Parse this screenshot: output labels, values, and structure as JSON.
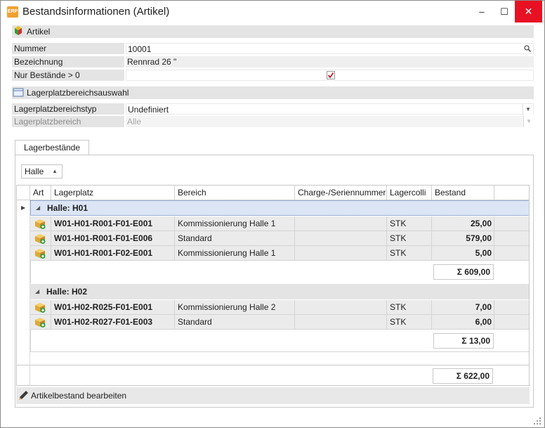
{
  "window": {
    "title": "Bestandsinformationen (Artikel)",
    "app_icon_text": "ERP",
    "minimize_glyph": "–",
    "maximize_glyph": "☐",
    "close_glyph": "✕"
  },
  "artikel_section": {
    "header": "Artikel",
    "fields": {
      "nummer_label": "Nummer",
      "nummer_value": "10001",
      "bezeichnung_label": "Bezeichnung",
      "bezeichnung_value": "Rennrad 26 \"",
      "nur_bestaende_label": "Nur Bestände > 0",
      "nur_bestaende_checked": true
    }
  },
  "lagerplatz_section": {
    "header": "Lagerplatzbereichsauswahl",
    "fields": {
      "typ_label": "Lagerplatzbereichstyp",
      "typ_value": "Undefiniert",
      "bereich_label": "Lagerplatzbereich",
      "bereich_value": "Alle"
    }
  },
  "tabs": {
    "active": "Lagerbestände"
  },
  "group_by_chip": {
    "label": "Halle",
    "sort_arrow": "▲"
  },
  "grid": {
    "columns": [
      "Art",
      "Lagerplatz",
      "Bereich",
      "Charge-/Seriennummer",
      "Lagercolli",
      "Bestand"
    ],
    "groups": [
      {
        "label": "Halle: H01",
        "rows": [
          {
            "lagerplatz": "W01-H01-R001-F01-E001",
            "bereich": "Kommissionierung Halle 1",
            "charge": "",
            "lagercolli": "STK",
            "bestand": "25,00"
          },
          {
            "lagerplatz": "W01-H01-R001-F01-E006",
            "bereich": "Standard",
            "charge": "",
            "lagercolli": "STK",
            "bestand": "579,00"
          },
          {
            "lagerplatz": "W01-H01-R001-F02-E001",
            "bereich": "Kommissionierung Halle 1",
            "charge": "",
            "lagercolli": "STK",
            "bestand": "5,00"
          }
        ],
        "sum": "Σ 609,00"
      },
      {
        "label": "Halle: H02",
        "rows": [
          {
            "lagerplatz": "W01-H02-R025-F01-E001",
            "bereich": "Kommissionierung Halle 2",
            "charge": "",
            "lagercolli": "STK",
            "bestand": "7,00"
          },
          {
            "lagerplatz": "W01-H02-R027-F01-E003",
            "bereich": "Standard",
            "charge": "",
            "lagercolli": "STK",
            "bestand": "6,00"
          }
        ],
        "sum": "Σ 13,00"
      }
    ],
    "total_sum": "Σ 622,00"
  },
  "footer": {
    "action_label": "Artikelbestand bearbeiten"
  },
  "colors": {
    "section_bg": "#e4e4e4",
    "focus_row": "#dbe5f5",
    "close_button": "#e81123",
    "checkbox_mark": "#c0202a"
  },
  "icons": {
    "artikel": "items-icon",
    "lagerplatz": "storage-area-icon",
    "row_type": "box-add-icon",
    "edit": "pencil-icon",
    "search": "magnifier-icon"
  }
}
